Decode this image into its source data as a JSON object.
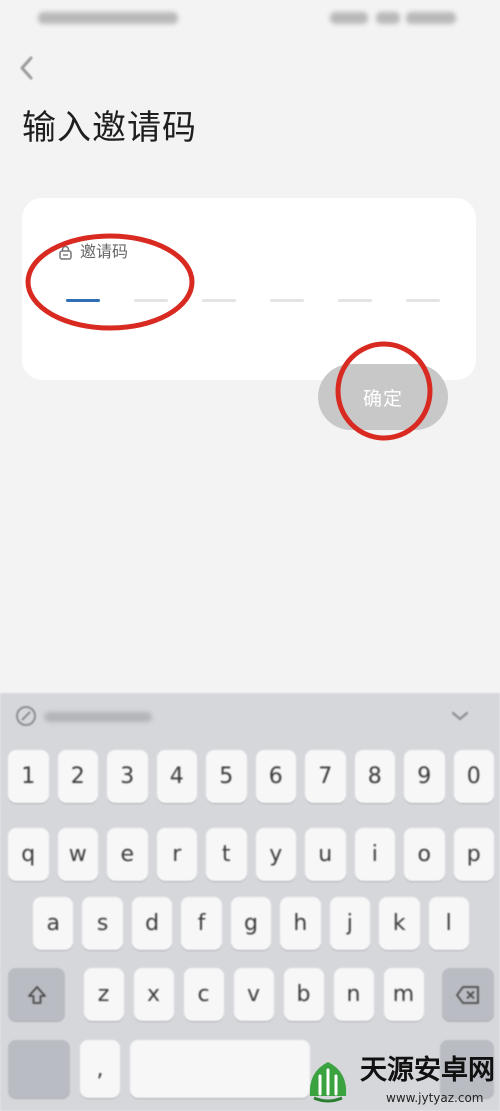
{
  "header": {
    "back_icon": "back-arrow-icon",
    "title": "输入邀请码"
  },
  "invite_card": {
    "label_icon": "lock-icon",
    "label": "邀请码",
    "code_length": 6,
    "active_slot": 0
  },
  "confirm_button": {
    "label": "确定"
  },
  "keyboard": {
    "suggestion_bar": {
      "left_icon": "pen-icon",
      "right_icon": "chevron-down-icon"
    },
    "number_row": [
      "1",
      "2",
      "3",
      "4",
      "5",
      "6",
      "7",
      "8",
      "9",
      "0"
    ],
    "top_row": [
      "q",
      "w",
      "e",
      "r",
      "t",
      "y",
      "u",
      "i",
      "o",
      "p"
    ],
    "middle_row": [
      "a",
      "s",
      "d",
      "f",
      "g",
      "h",
      "j",
      "k",
      "l"
    ],
    "bottom_row": [
      "z",
      "x",
      "c",
      "v",
      "b",
      "n",
      "m"
    ],
    "shift_icon": "shift-icon",
    "backspace_icon": "backspace-icon",
    "comma_key": ","
  },
  "watermark": {
    "logo": "sprout-logo-icon",
    "name": "天源安卓网",
    "url": "www.jytyaz.com"
  },
  "colors": {
    "accent": "#2f6db5",
    "annotation": "#d92a21",
    "button_disabled": "#c8c8c8"
  }
}
